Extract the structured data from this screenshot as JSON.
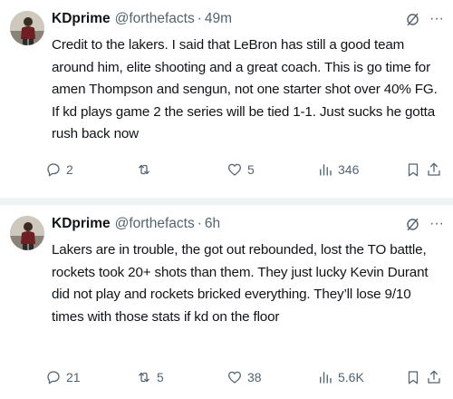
{
  "colors": {
    "text": "#0f1419",
    "secondary": "#536471",
    "divider": "#eff3f4"
  },
  "tweets": [
    {
      "display_name": "KDprime",
      "handle": "@forthefacts",
      "separator": "·",
      "time": "49m",
      "text": "Credit to the lakers. I said that LeBron has still a good team around him, elite shooting and a great coach. This is go time for amen Thompson and sengun, not one starter shot over 40% FG. If kd plays game 2 the series will be tied 1-1. Just sucks he gotta rush back now",
      "replies": "2",
      "reposts": "",
      "likes": "5",
      "views": "346"
    },
    {
      "display_name": "KDprime",
      "handle": "@forthefacts",
      "separator": "·",
      "time": "6h",
      "text": "Lakers are in trouble, the got out rebounded, lost the TO battle, rockets took 20+ shots than them. They just lucky Kevin Durant did not play and rockets bricked everything. They’ll lose 9/10 times with those stats if kd on the floor",
      "replies": "21",
      "reposts": "5",
      "likes": "38",
      "views": "5.6K"
    }
  ],
  "icons": {
    "avatar": "avatar-image",
    "grok": "grok-icon",
    "more": "more-icon",
    "more_glyph": "···",
    "reply": "reply-icon",
    "repost": "repost-icon",
    "like": "heart-icon",
    "views": "views-icon",
    "bookmark": "bookmark-icon",
    "share": "share-icon"
  }
}
